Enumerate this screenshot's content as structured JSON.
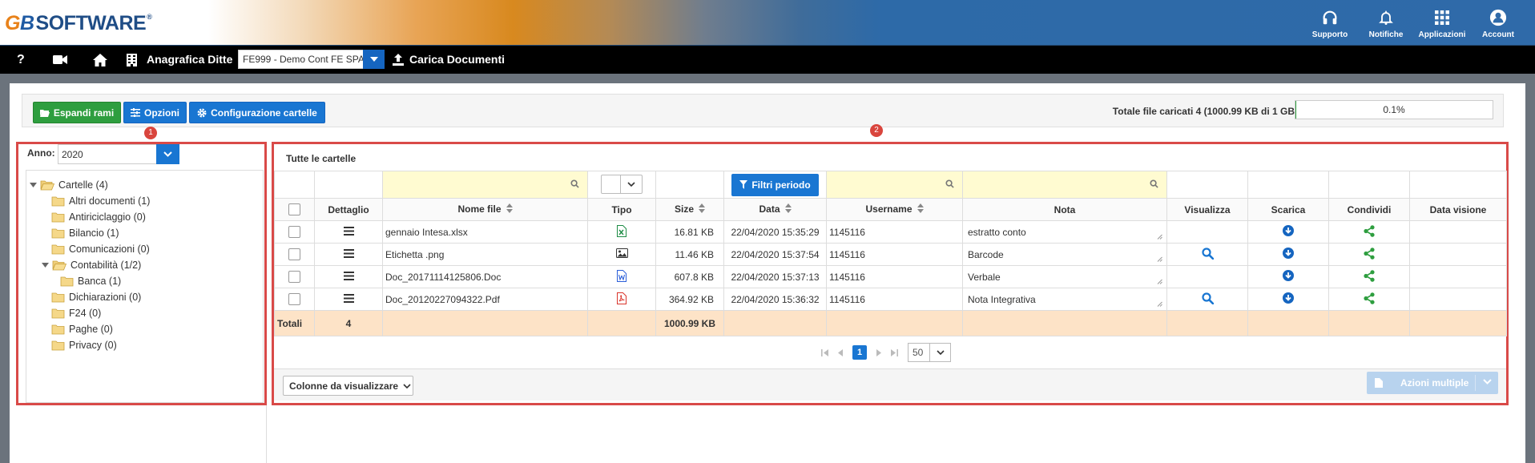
{
  "header": {
    "logo_g": "G",
    "logo_b": "B",
    "logo_text": "SOFTWARE",
    "logo_reg": "®",
    "buttons": [
      {
        "label": "Supporto",
        "icon": "headset-icon"
      },
      {
        "label": "Notifiche",
        "icon": "bell-icon"
      },
      {
        "label": "Applicazioni",
        "icon": "apps-grid-icon"
      },
      {
        "label": "Account",
        "icon": "account-icon"
      }
    ]
  },
  "navbar": {
    "help": "?",
    "anagrafica_label": "Anagrafica Ditte",
    "ditta_selected": "FE999 - Demo Cont FE SPA",
    "carica_label": "Carica Documenti"
  },
  "toolbar": {
    "espandi": "Espandi rami",
    "opzioni": "Opzioni",
    "configurazione": "Configurazione cartelle",
    "quota_label": "Totale file caricati 4 (1000.99 KB di 1 GB)",
    "quota_percent": "0.1%",
    "quota_fraction": 0.001
  },
  "badges": {
    "one": "1",
    "two": "2"
  },
  "left": {
    "anno_label": "Anno:",
    "anno_value": "2020",
    "tree": [
      {
        "label": "Cartelle (4)",
        "level": 0,
        "open": true
      },
      {
        "label": "Altri documenti (1)",
        "level": 1
      },
      {
        "label": "Antiriciclaggio (0)",
        "level": 1
      },
      {
        "label": "Bilancio (1)",
        "level": 1
      },
      {
        "label": "Comunicazioni (0)",
        "level": 1
      },
      {
        "label": "Contabilità (1/2)",
        "level": 1,
        "open": true
      },
      {
        "label": "Banca (1)",
        "level": 2
      },
      {
        "label": "Dichiarazioni (0)",
        "level": 1
      },
      {
        "label": "F24 (0)",
        "level": 1
      },
      {
        "label": "Paghe (0)",
        "level": 1
      },
      {
        "label": "Privacy (0)",
        "level": 1
      }
    ]
  },
  "grid": {
    "title": "Tutte le cartelle",
    "filtri_periodo": "Filtri periodo",
    "columns": [
      "Dettaglio",
      "Nome file",
      "Tipo",
      "Size",
      "Data",
      "Username",
      "Nota",
      "Visualizza",
      "Scarica",
      "Condividi",
      "Data visione"
    ],
    "rows": [
      {
        "nome": "gennaio Intesa.xlsx",
        "tipo": "excel",
        "size": "16.81 KB",
        "data": "22/04/2020 15:35:29",
        "user": "1145116",
        "nota": "estratto conto",
        "view": false
      },
      {
        "nome": "Etichetta .png",
        "tipo": "image",
        "size": "11.46 KB",
        "data": "22/04/2020 15:37:54",
        "user": "1145116",
        "nota": "Barcode",
        "view": true
      },
      {
        "nome": "Doc_20171114125806.Doc",
        "tipo": "word",
        "size": "607.8 KB",
        "data": "22/04/2020 15:37:13",
        "user": "1145116",
        "nota": "Verbale",
        "view": false
      },
      {
        "nome": "Doc_20120227094322.Pdf",
        "tipo": "pdf",
        "size": "364.92 KB",
        "data": "22/04/2020 15:36:32",
        "user": "1145116",
        "nota": "Nota Integrativa",
        "view": true
      }
    ],
    "totals": {
      "label": "Totali",
      "count": "4",
      "size": "1000.99 KB"
    },
    "pager": {
      "page": "1",
      "size": "50"
    },
    "colonne_btn": "Colonne da visualizzare",
    "azioni_btn": "Azioni multiple"
  },
  "colors": {
    "primary": "#1976d2",
    "success": "#2e9e3f",
    "danger": "#d94a48",
    "totals_bg": "#fde3c7",
    "filter_bg": "#fffbd1"
  }
}
